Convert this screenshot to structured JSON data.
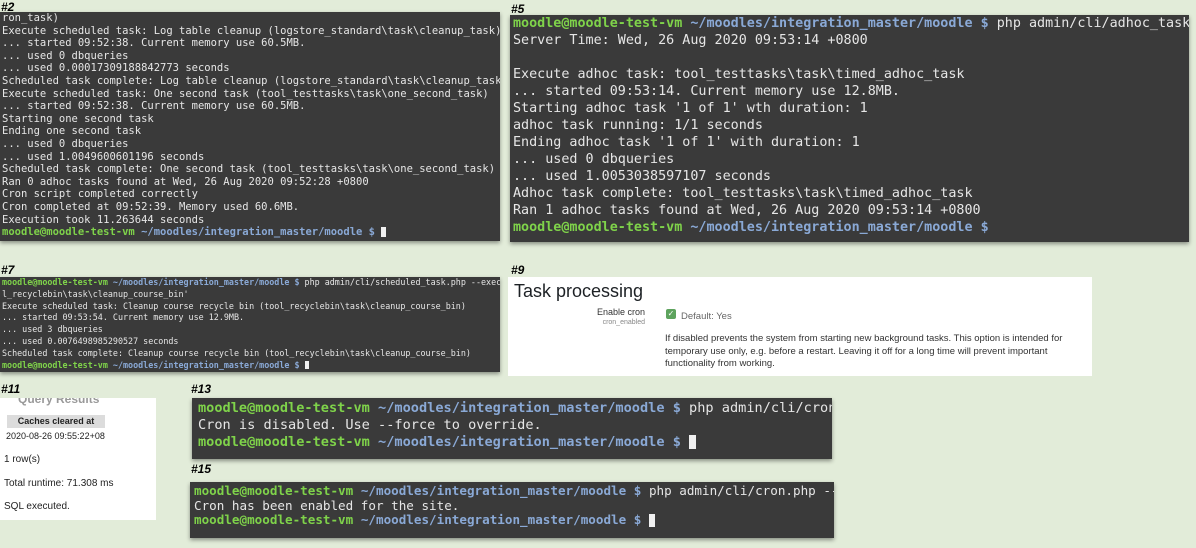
{
  "prompt": {
    "user_host": "moodle@moodle-test-vm",
    "path": " ~/moodles/integration_master/moodle $"
  },
  "panels": {
    "p2": {
      "label": "#2",
      "lines": [
        "ron_task)",
        "Execute scheduled task: Log table cleanup (logstore_standard\\task\\cleanup_task)",
        "... started 09:52:38. Current memory use 60.5MB.",
        "... used 0 dbqueries",
        "... used 0.00017309188842773 seconds",
        "Scheduled task complete: Log table cleanup (logstore_standard\\task\\cleanup_task)",
        "Execute scheduled task: One second task (tool_testtasks\\task\\one_second_task)",
        "... started 09:52:38. Current memory use 60.5MB.",
        "Starting one second task",
        "Ending one second task",
        "... used 0 dbqueries",
        "... used 1.0049600601196 seconds",
        "Scheduled task complete: One second task (tool_testtasks\\task\\one_second_task)",
        "Ran 0 adhoc tasks found at Wed, 26 Aug 2020 09:52:28 +0800",
        "Cron script completed correctly",
        "Cron completed at 09:52:39. Memory used 60.6MB.",
        "Execution took 11.263644 seconds"
      ]
    },
    "p5": {
      "label": "#5",
      "command": " php admin/cli/adhoc_task.php --execute",
      "lines": [
        "Server Time: Wed, 26 Aug 2020 09:53:14 +0800",
        "",
        "Execute adhoc task: tool_testtasks\\task\\timed_adhoc_task",
        "... started 09:53:14. Current memory use 12.8MB.",
        "Starting adhoc task '1 of 1' wth duration: 1",
        "adhoc task running: 1/1 seconds",
        "Ending adhoc task '1 of 1' with duration: 1",
        "... used 0 dbqueries",
        "... used 1.0053038597107 seconds",
        "Adhoc task complete: tool_testtasks\\task\\timed_adhoc_task",
        "Ran 1 adhoc tasks found at Wed, 26 Aug 2020 09:53:14 +0800"
      ]
    },
    "p7": {
      "label": "#7",
      "command": " php admin/cli/scheduled_task.php --execute='\\too",
      "command_wrap": "l_recyclebin\\task\\cleanup_course_bin'",
      "lines": [
        "Execute scheduled task: Cleanup course recycle bin (tool_recyclebin\\task\\cleanup_course_bin)",
        "... started 09:53:54. Current memory use 12.9MB.",
        "... used 3 dbqueries",
        "... used 0.0076498985290527 seconds",
        "Scheduled task complete: Cleanup course recycle bin (tool_recyclebin\\task\\cleanup_course_bin)"
      ]
    },
    "p9": {
      "label": "#9",
      "heading": "Task processing",
      "setting_name": "Enable cron",
      "setting_id": "cron_enabled",
      "default_text": "Default: Yes",
      "checkbox_checked": true,
      "description": "If disabled prevents the system from starting new background tasks. This option is intended for temporary use only, e.g. before a restart. Leaving it off for a long time will prevent important functionality from working."
    },
    "p11": {
      "label": "#11",
      "title": "Query Results",
      "cache_header": "Caches cleared at",
      "cache_value": "2020-08-26 09:55:22+08",
      "rows": "1 row(s)",
      "runtime": "Total runtime: 71.308 ms",
      "sql": "SQL executed."
    },
    "p13": {
      "label": "#13",
      "command": " php admin/cli/cron.php",
      "output": "Cron is disabled. Use --force to override."
    },
    "p15": {
      "label": "#15",
      "command": " php admin/cli/cron.php --enable",
      "output": "Cron has been enabled for the site."
    }
  },
  "colors": {
    "background": "#e2ecd9",
    "terminal_bg": "#3a3a3a",
    "prompt_user": "#7fd34a",
    "prompt_path": "#8aa9d6"
  }
}
